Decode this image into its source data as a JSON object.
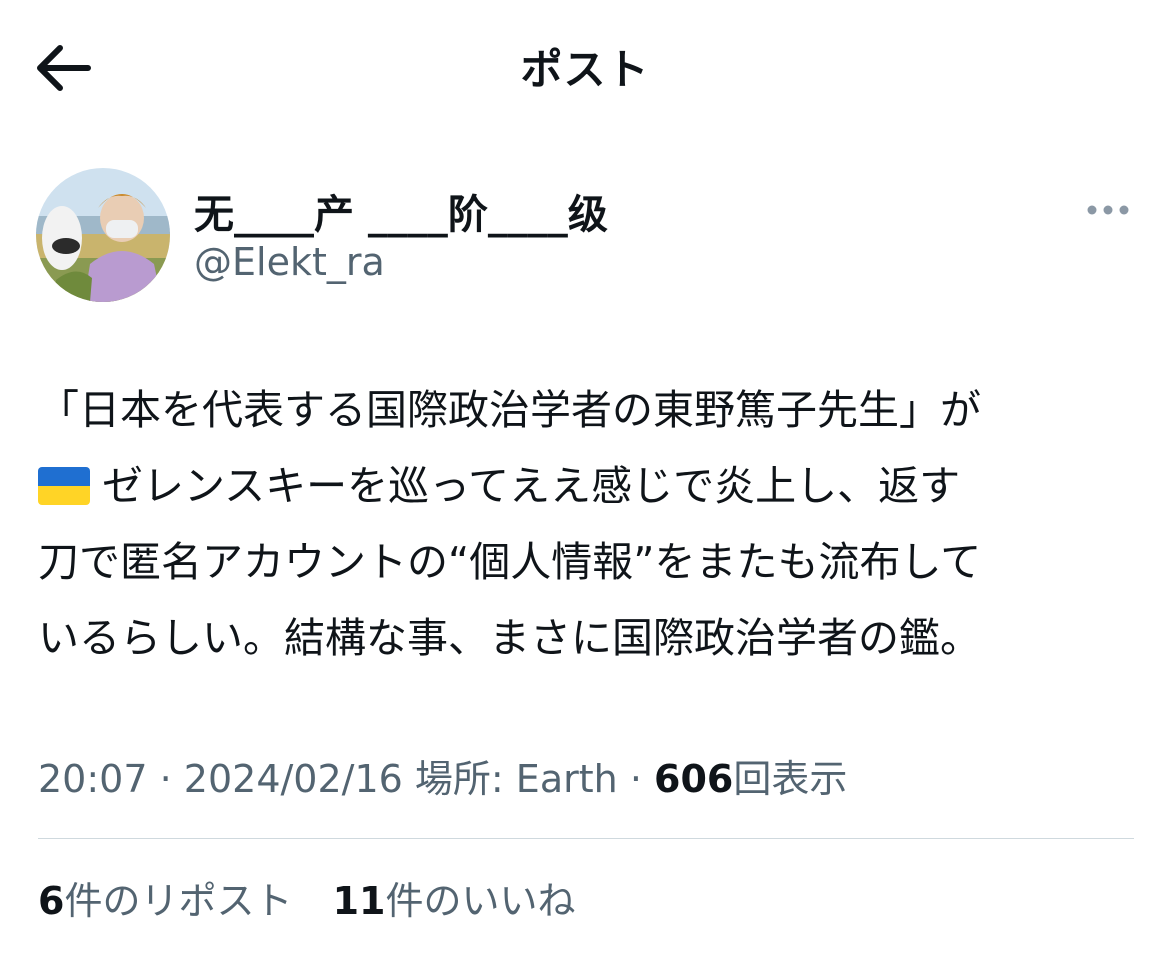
{
  "header": {
    "title": "ポスト",
    "back_icon": "arrow-left-icon"
  },
  "author": {
    "display_name": "无____产 ____阶____级",
    "handle": "@Elekt_ra",
    "more_icon": "more-horizontal-icon"
  },
  "tweet": {
    "line1": "「日本を代表する国際政治学者の東野篤子先生」が",
    "flag_emoji": "🇺🇦",
    "line2": "ゼレンスキーを巡ってええ感じで炎上し、返す",
    "line3": "刀で匿名アカウントの“個人情報”をまたも流布して",
    "line4": "いるらしい。結構な事、まさに国際政治学者の鑑。"
  },
  "meta": {
    "time": "20:07",
    "date": "2024/02/16",
    "location_label": "場所: Earth",
    "separator": "·",
    "views_count": "606",
    "views_label": "回表示"
  },
  "stats": {
    "reposts_count": "6",
    "reposts_label": "件のリポスト",
    "likes_count": "11",
    "likes_label": "件のいいね"
  },
  "colors": {
    "text_primary": "#0f1419",
    "text_secondary": "#536471",
    "divider": "#cfd9de"
  }
}
